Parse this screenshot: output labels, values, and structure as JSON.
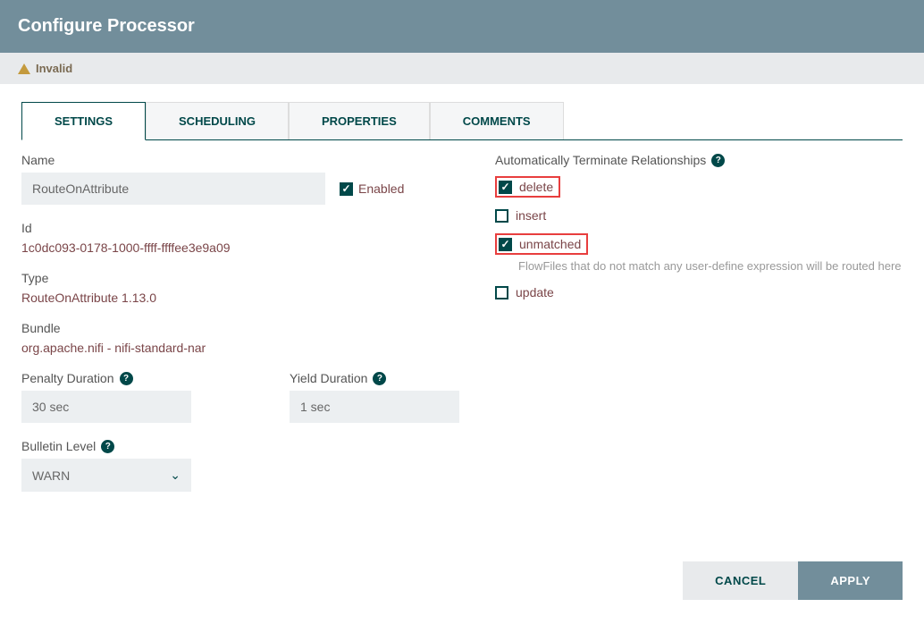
{
  "header": {
    "title": "Configure Processor"
  },
  "status": {
    "text": "Invalid"
  },
  "tabs": [
    {
      "label": "SETTINGS",
      "active": true
    },
    {
      "label": "SCHEDULING",
      "active": false
    },
    {
      "label": "PROPERTIES",
      "active": false
    },
    {
      "label": "COMMENTS",
      "active": false
    }
  ],
  "fields": {
    "name_label": "Name",
    "name_value": "RouteOnAttribute",
    "enabled_label": "Enabled",
    "id_label": "Id",
    "id_value": "1c0dc093-0178-1000-ffff-ffffee3e9a09",
    "type_label": "Type",
    "type_value": "RouteOnAttribute 1.13.0",
    "bundle_label": "Bundle",
    "bundle_value": "org.apache.nifi - nifi-standard-nar",
    "penalty_label": "Penalty Duration",
    "penalty_value": "30 sec",
    "yield_label": "Yield Duration",
    "yield_value": "1 sec",
    "bulletin_label": "Bulletin Level",
    "bulletin_value": "WARN"
  },
  "relationships": {
    "title": "Automatically Terminate Relationships",
    "items": [
      {
        "label": "delete",
        "checked": true,
        "highlighted": true,
        "desc": ""
      },
      {
        "label": "insert",
        "checked": false,
        "highlighted": false,
        "desc": ""
      },
      {
        "label": "unmatched",
        "checked": true,
        "highlighted": true,
        "desc": "FlowFiles that do not match any user-define expression will be routed here"
      },
      {
        "label": "update",
        "checked": false,
        "highlighted": false,
        "desc": ""
      }
    ]
  },
  "footer": {
    "cancel": "CANCEL",
    "apply": "APPLY"
  }
}
